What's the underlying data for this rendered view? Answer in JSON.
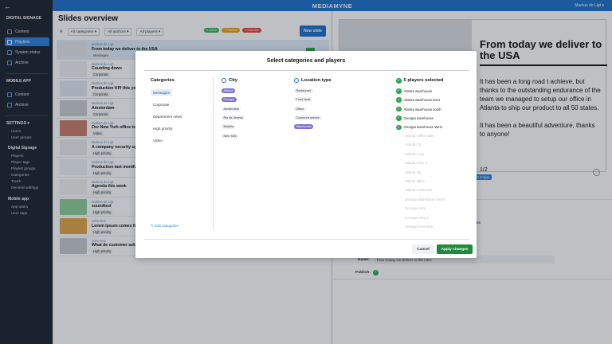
{
  "app": {
    "brand": "MEDIAMYNE",
    "user": "Markus de Ligt ▾"
  },
  "sidebar": {
    "back": "←",
    "digital_signage": "DIGITAL SIGNAGE",
    "ds_items": [
      {
        "label": "Content"
      },
      {
        "label": "Playlists"
      },
      {
        "label": "System status"
      },
      {
        "label": "Archive"
      }
    ],
    "mobile_app": "MOBILE APP",
    "ma_items": [
      {
        "label": "Content"
      },
      {
        "label": "Archive"
      }
    ],
    "settings": "SETTINGS ▾",
    "settings_items": [
      "Users",
      "User groups"
    ],
    "ds_settings_h": "Digital Signage",
    "ds_settings": [
      "Players",
      "Player tags",
      "Playlist groups",
      "Categories",
      "Touch",
      "General settings"
    ],
    "ma_settings_h": "Mobile app",
    "ma_settings": [
      "App users",
      "User tags"
    ]
  },
  "list": {
    "title": "Slides overview",
    "filters": [
      "All categories ▾",
      "All authors ▾",
      "All players ▾"
    ],
    "tags": [
      {
        "label": "4 active",
        "color": "#3ab55a"
      },
      {
        "label": "1 Planned",
        "color": "#e8a317"
      },
      {
        "label": "1 Overdue",
        "color": "#e0453f"
      }
    ],
    "new_slide": "New slide",
    "rows": [
      {
        "author": "Markus de Ligt",
        "name": "From today we deliver to the USA",
        "category": "Messages",
        "thumb": "#e5e7ea"
      },
      {
        "author": "Markus de Ligt",
        "name": "Counting down",
        "category": "Corporate",
        "thumb": "#eef0f2"
      },
      {
        "author": "Markus de Ligt",
        "name": "Production KPI this year",
        "category": "Corporate",
        "thumb": "#dfe9f3"
      },
      {
        "author": "Markus de Ligt",
        "name": "Amsterdam",
        "category": "Corporate",
        "thumb": "#c9cdd2"
      },
      {
        "author": "Markus de Ligt",
        "name": "Our New York office is ...",
        "category": "Video",
        "thumb": "#c97e6b"
      },
      {
        "author": "Markus de Ligt",
        "name": "A company security upd...",
        "category": "High priority",
        "thumb": "#e9ecef"
      },
      {
        "author": "Markus de Ligt",
        "name": "Production last month",
        "category": "High priority",
        "thumb": "#eef2f5"
      },
      {
        "author": "Markus de Ligt",
        "name": "Agenda this week",
        "category": "High priority",
        "thumb": "#f1f1f1"
      },
      {
        "author": "Markus de Ligt",
        "name": "soundtest",
        "category": "High priority",
        "thumb": "#8ccf9a"
      },
      {
        "author": "John Doe",
        "name": "Lorem ipsum comes fro...",
        "category": "High priority",
        "thumb": "#e2a548"
      },
      {
        "author": "John Doe",
        "name": "What de customer ask ...",
        "category": "High priority",
        "thumb": "#c7cbd0"
      }
    ]
  },
  "preview": {
    "title": "From today we deliver to the USA",
    "body1": "It has been a long road t achieve, but thanks to the outstanding endurance of the team we managed to setup our office in Atlanta to ship our product to all 50 states.",
    "body2": "It has been a beautiful adventure, thanks to anyone!",
    "page": "1/2",
    "edit_image": "Edit image",
    "side_num": "55",
    "name_label": "Name:",
    "name_value": "From today we deliver to the USA",
    "publish_label": "Publish:"
  },
  "modal": {
    "title": "Select categories and players",
    "categories_h": "Categories",
    "categories": [
      {
        "label": "Messages",
        "on": true
      },
      {
        "label": "Corporate",
        "on": false
      },
      {
        "label": "Department news",
        "on": false
      },
      {
        "label": "High priority",
        "on": false
      },
      {
        "label": "Video",
        "on": false
      }
    ],
    "edit_categories": "Edit categories",
    "city_h": "City",
    "cities": [
      {
        "label": "Atlanta",
        "on": true
      },
      {
        "label": "Georgia",
        "on": true
      },
      {
        "label": "Amsterdam",
        "on": false
      },
      {
        "label": "Rio de Janeiro",
        "on": false
      },
      {
        "label": "Brasilia",
        "on": false
      },
      {
        "label": "New York",
        "on": false
      }
    ],
    "location_h": "Location type",
    "locations": [
      {
        "label": "Restaurant",
        "on": false
      },
      {
        "label": "Front desk",
        "on": false
      },
      {
        "label": "Office",
        "on": false
      },
      {
        "label": "Customer service",
        "on": false
      },
      {
        "label": "Warehouse",
        "on": true
      }
    ],
    "players_h": "5 players selected",
    "players_on": [
      "Atlanta warehouse",
      "Atlanta warehouse East",
      "Atlanta warehouse south",
      "Georgia warehouse",
      "Georgia warehouse West"
    ],
    "players_off": [
      "Atlanta coffee table",
      "Atlanta CS",
      "Atlanta entry",
      "Atlanta entry 2",
      "Atlanta HQ",
      "Atlanta office",
      "Atlanta restaurant",
      "Georgia distribution centre",
      "Georgia entry",
      "Georgia entry 2",
      "Georgia front desk"
    ],
    "cancel": "Cancel",
    "apply": "Apply changes"
  }
}
